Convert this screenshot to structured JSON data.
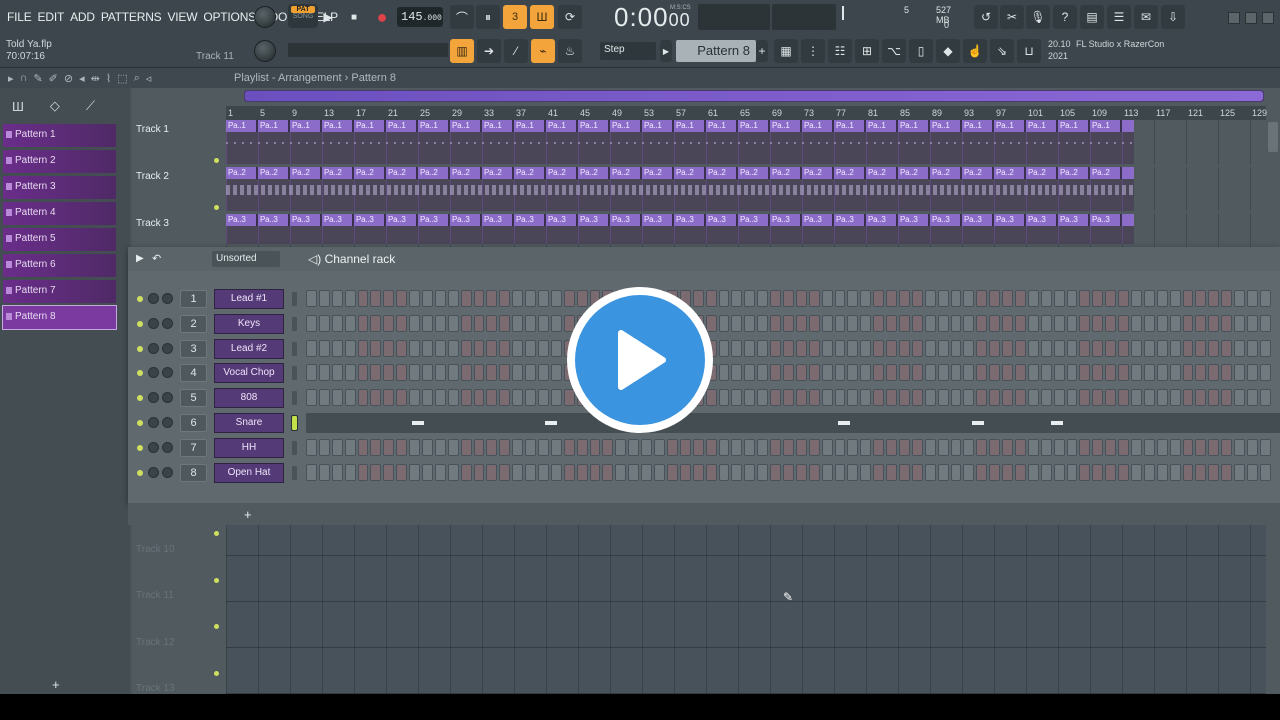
{
  "menu": [
    "FILE",
    "EDIT",
    "ADD",
    "PATTERNS",
    "VIEW",
    "OPTIONS",
    "TOOLS",
    "HELP"
  ],
  "project": {
    "file": "Told Ya.flp",
    "time": "70:07:16",
    "hint_track": "Track 11"
  },
  "transport": {
    "pat_label": "PAT",
    "song_label": "SONG",
    "tempo": "145",
    "tempo_decimals": ".000",
    "time": "0:00",
    "time_cs": "00",
    "time_unit": "M:S:CS"
  },
  "cpu": {
    "value": "5",
    "memory": "527 MB",
    "polyphony": "0"
  },
  "toolbar2": {
    "snap": "Step",
    "pattern": "Pattern 8"
  },
  "news": {
    "version": "20.10",
    "year": "2021",
    "title": "FL Studio x RazerCon"
  },
  "playlist": {
    "crumb": "Playlist - Arrangement › Pattern 8",
    "patterns": [
      "Pattern 1",
      "Pattern 2",
      "Pattern 3",
      "Pattern 4",
      "Pattern 5",
      "Pattern 6",
      "Pattern 7",
      "Pattern 8"
    ],
    "selected_pattern": "Pattern 8",
    "ruler": [
      "1",
      "5",
      "9",
      "13",
      "17",
      "21",
      "25",
      "29",
      "33",
      "37",
      "41",
      "45",
      "49",
      "53",
      "57",
      "61",
      "65",
      "69",
      "73",
      "77",
      "81",
      "85",
      "89",
      "93",
      "97",
      "101",
      "105",
      "109",
      "113",
      "117",
      "121",
      "125",
      "129"
    ],
    "tracks": [
      "Track 1",
      "Track 2",
      "Track 3"
    ],
    "lower_tracks": [
      "Track 10",
      "Track 11",
      "Track 12",
      "Track 13"
    ],
    "clip_labels": [
      "Pa..1",
      "Pa..2",
      "Pa..3"
    ]
  },
  "channel_rack": {
    "title": "Channel rack",
    "sort": "Unsorted",
    "channels": [
      {
        "num": "1",
        "name": "Lead #1"
      },
      {
        "num": "2",
        "name": "Keys"
      },
      {
        "num": "3",
        "name": "Lead #2"
      },
      {
        "num": "4",
        "name": "Vocal Chop"
      },
      {
        "num": "5",
        "name": "808"
      },
      {
        "num": "6",
        "name": "Snare"
      },
      {
        "num": "7",
        "name": "HH"
      },
      {
        "num": "8",
        "name": "Open Hat"
      }
    ]
  },
  "colors": {
    "accent": "#f3a53b",
    "pattern": "#6a2d8a",
    "play_overlay": "#3a94e0"
  }
}
